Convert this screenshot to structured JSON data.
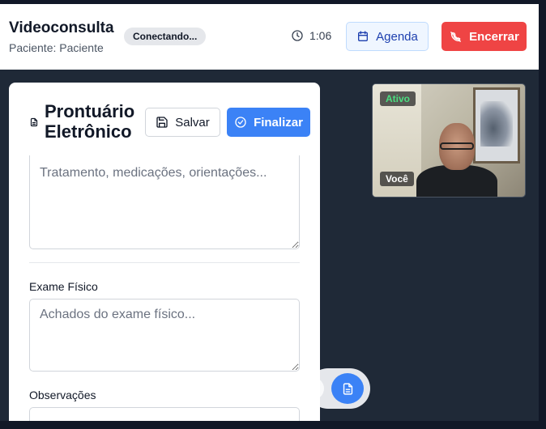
{
  "header": {
    "title": "Videoconsulta",
    "patient_label": "Paciente: Paciente",
    "status_badge": "Conectando...",
    "timer": "1:06",
    "agenda_label": "Agenda",
    "end_label": "Encerrar"
  },
  "video": {
    "active_tag": "Ativo",
    "self_tag": "Você"
  },
  "record_panel": {
    "title": "Prontuário Eletrônico",
    "save_label": "Salvar",
    "finish_label": "Finalizar",
    "treatment_placeholder": "Tratamento, medicações, orientações...",
    "exam_label": "Exame Físico",
    "exam_placeholder": "Achados do exame físico...",
    "observations_label": "Observações"
  },
  "colors": {
    "background": "#1f2937",
    "primary": "#3b82f6",
    "danger": "#ef4444",
    "active_green": "#4ade80"
  },
  "icons": [
    "clock-icon",
    "calendar-icon",
    "phone-off-icon",
    "file-text-icon",
    "save-icon",
    "check-circle-icon"
  ]
}
